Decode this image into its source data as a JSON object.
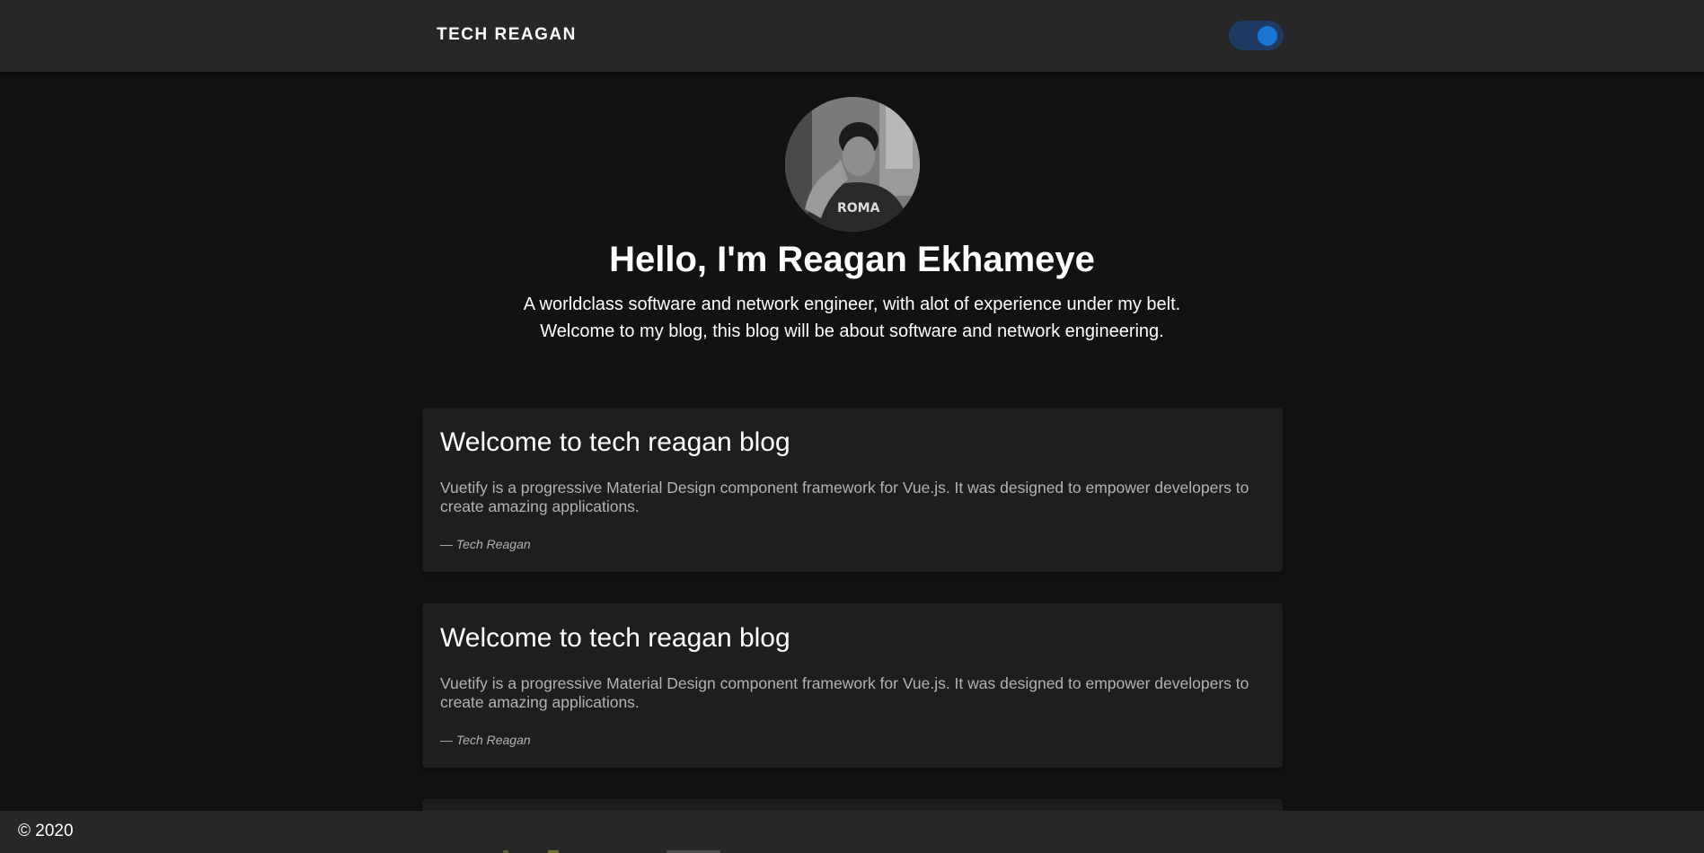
{
  "appbar": {
    "brand": "TECH REAGAN",
    "theme_toggle": {
      "state": "on",
      "track_color": "#1e3c63",
      "knob_color": "#1976d2"
    }
  },
  "hero": {
    "avatar_alt": "profile-photo",
    "title": "Hello, I'm Reagan Ekhameye",
    "lines": [
      "A worldclass software and network engineer, with alot of experience under my belt.",
      "Welcome to my blog, this blog will be about software and network engineering."
    ]
  },
  "posts": [
    {
      "title": "Welcome to tech reagan blog",
      "text": "Vuetify is a progressive Material Design component framework for Vue.js. It was designed to empower developers to create amazing applications.",
      "author": "— Tech Reagan"
    },
    {
      "title": "Welcome to tech reagan blog",
      "text": "Vuetify is a progressive Material Design component framework for Vue.js. It was designed to empower developers to create amazing applications.",
      "author": "— Tech Reagan"
    }
  ],
  "footer": {
    "copyright": "© 2020"
  },
  "colors": {
    "background": "#121212",
    "appbar": "#272727",
    "card": "#1e1e1e",
    "accent": "#1976d2"
  }
}
